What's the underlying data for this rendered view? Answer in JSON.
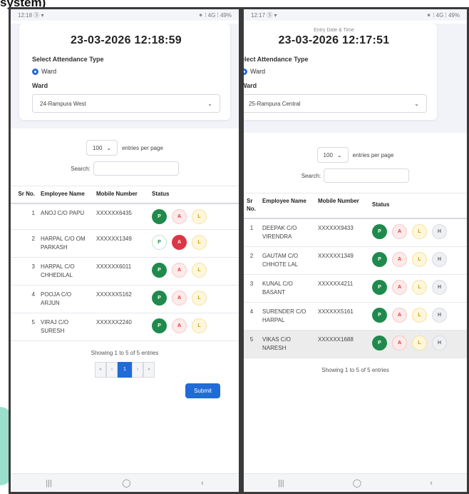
{
  "caption": "system)",
  "left": {
    "status": {
      "time": "12:18",
      "icons": "Ⓢ ▾",
      "right": "⁕ ⁞ 4G ⁞ 49%"
    },
    "time_label": "",
    "datetime": "23-03-2026 12:18:59",
    "attendance_type_label": "Select Attendance Type",
    "radio_label": "Ward",
    "ward_label": "Ward",
    "ward_value": "24-Rampura West",
    "entries_value": "100",
    "entries_label": "entries per page",
    "search_label": "Search:",
    "columns": [
      "Sr No.",
      "Employee Name",
      "Mobile Number",
      "Status"
    ],
    "rows": [
      {
        "sr": "1",
        "name": "ANOJ C/O PAPU",
        "mobile": "XXXXXX6435",
        "status": "P"
      },
      {
        "sr": "2",
        "name": "HARPAL C/O OM PARKASH",
        "mobile": "XXXXXX1349",
        "status": "A"
      },
      {
        "sr": "3",
        "name": "HARPAL C/O CHHEDILAL",
        "mobile": "XXXXXX6011",
        "status": "P"
      },
      {
        "sr": "4",
        "name": "POOJA C/O ARJUN",
        "mobile": "XXXXXX5162",
        "status": "P"
      },
      {
        "sr": "5",
        "name": "VIRAJ C/O SURESH",
        "mobile": "XXXXXX2240",
        "status": "P"
      }
    ],
    "status_buttons": [
      "P",
      "A",
      "L"
    ],
    "showing": "Showing 1 to 5 of 5 entries",
    "pagination": [
      "«",
      "‹",
      "1",
      "›",
      "»"
    ],
    "submit": "Submit",
    "nav": [
      "|||",
      "◯",
      "‹"
    ]
  },
  "right": {
    "status": {
      "time": "12:17",
      "icons": "Ⓢ ▾",
      "right": "⁕ ⁞ 4G ⁞ 49%"
    },
    "time_label": "Entry Date & Time",
    "datetime": "23-03-2026 12:17:51",
    "attendance_type_label": "elect Attendance Type",
    "radio_label": "Ward",
    "ward_label": "Ward",
    "ward_value": "25-Rampura Central",
    "entries_value": "100",
    "entries_label": "entries per page",
    "search_label": "Search:",
    "columns": [
      "Sr No.",
      "Employee Name",
      "Mobile Number",
      "Status"
    ],
    "rows": [
      {
        "sr": "1",
        "name": "DEEPAK C/O VIRENDRA",
        "mobile": "XXXXXX9433",
        "status": "P"
      },
      {
        "sr": "2",
        "name": "GAUTAM C/O CHHOTE LAL",
        "mobile": "XXXXXX1349",
        "status": "P"
      },
      {
        "sr": "3",
        "name": "KUNAL C/O BASANT",
        "mobile": "XXXXXX4211",
        "status": "P"
      },
      {
        "sr": "4",
        "name": "SURENDER C/O HARPAL",
        "mobile": "XXXXXX5161",
        "status": "P"
      },
      {
        "sr": "5",
        "name": "VIKAS C/O NARESH",
        "mobile": "XXXXXX1688",
        "status": "P"
      }
    ],
    "status_buttons": [
      "P",
      "A",
      "L",
      "H"
    ],
    "showing": "Showing 1 to 5 of 5 entries",
    "nav": [
      "|||",
      "◯",
      "‹"
    ]
  }
}
